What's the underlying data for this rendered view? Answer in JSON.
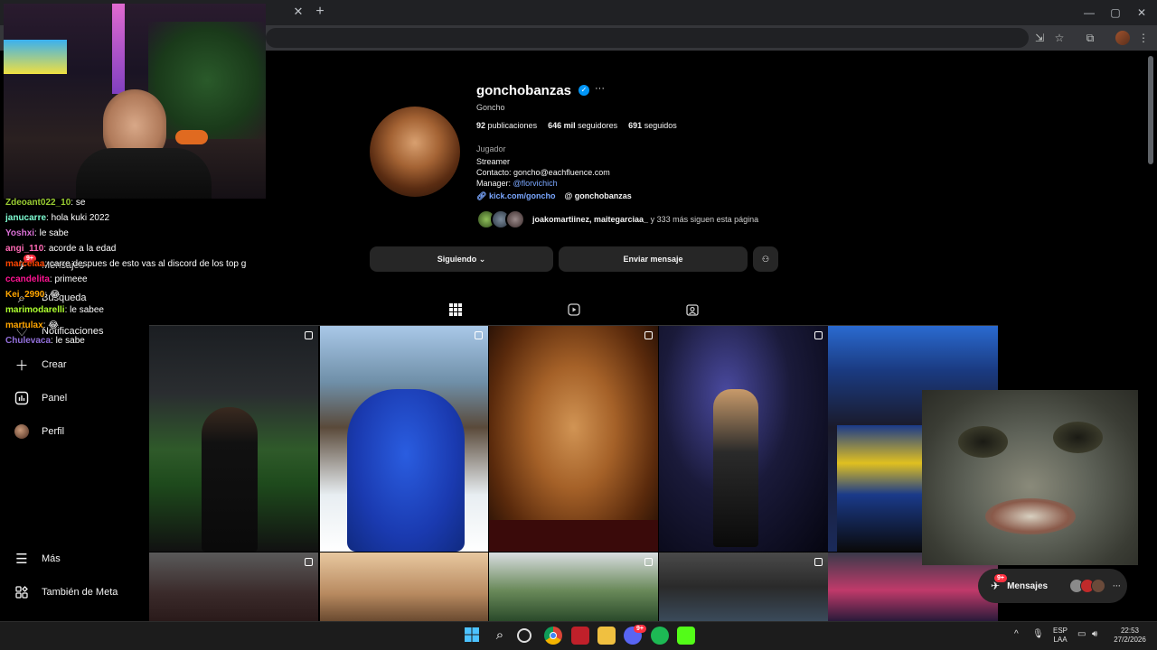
{
  "browser": {
    "tab_close": "✕",
    "new_tab": "+",
    "window": {
      "minimize": "—",
      "maximize": "▢",
      "close": "✕"
    }
  },
  "nav": {
    "create": "Crear",
    "panel": "Panel",
    "profile": "Perfil",
    "more": "Más",
    "meta": "También de Meta",
    "messages_behind": "Mensajes",
    "search_behind": "Búsqueda",
    "notifications_behind": "Notificaciones",
    "badge": "9+"
  },
  "profile": {
    "username": "gonchobanzas",
    "verified": "✓",
    "more": "···",
    "full_name": "Goncho",
    "stats": [
      {
        "value": "92",
        "label": "publicaciones"
      },
      {
        "value": "646 mil",
        "label": "seguidores"
      },
      {
        "value": "691",
        "label": "seguidos"
      }
    ],
    "category": "Jugador",
    "bio_line1": "Streamer",
    "bio_contact": "Contacto: goncho@eachfluence.com",
    "bio_manager_prefix": "Manager: ",
    "bio_manager_handle": "@florvichich",
    "link_kick": "kick.com/goncho",
    "link_threads": "gonchobanzas",
    "mutuals_names": "joakomartiinez, maitegarciaa_",
    "mutuals_rest": " y 333 más siguen esta página",
    "btn_following": "Siguiendo",
    "btn_message": "Enviar mensaje"
  },
  "chat": [
    {
      "user": "Zdeoant022_10",
      "color": "#9acd32",
      "text": ": se"
    },
    {
      "user": "janucarre",
      "color": "#7fffd4",
      "text": ": hola kuki 2022"
    },
    {
      "user": "Yoshxi",
      "color": "#da70d6",
      "text": ": le sabe"
    },
    {
      "user": "angi_110",
      "color": "#ff69b4",
      "text": ": acorde a la edad"
    },
    {
      "user": "marcelaa",
      "color": "#ff4500",
      "text": ": carre despues de esto vas al discord de los top g"
    },
    {
      "user": "ccandelita",
      "color": "#ff1493",
      "text": ": primeee"
    },
    {
      "user": "Kei_2990",
      "color": "#ffa500",
      "text": ": 😂"
    },
    {
      "user": "marimodarelli",
      "color": "#adff2f",
      "text": ": le sabee"
    },
    {
      "user": "martulax",
      "color": "#ffa500",
      "text": ": 😂"
    },
    {
      "user": "Chulevaca",
      "color": "#9370db",
      "text": ": le sabe"
    }
  ],
  "messages_pill": {
    "label": "Mensajes",
    "badge": "9+"
  },
  "taskbar": {
    "lang_top": "ESP",
    "lang_bottom": "LAA",
    "time": "22:53",
    "date": "27/2/2026",
    "chrome_badge": "9+"
  },
  "colors": {
    "accent_blue": "#0095f6",
    "link_blue": "#7aa7ff",
    "badge_red": "#ff3040",
    "button_bg": "#262626"
  }
}
